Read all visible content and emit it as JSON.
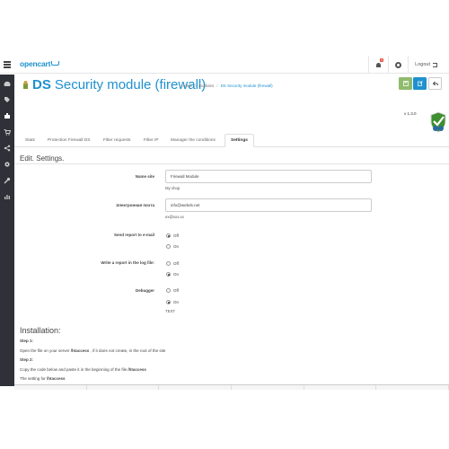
{
  "header": {
    "logo": "opencart",
    "notification_count": "3",
    "logout_label": "Logout"
  },
  "sidebar": {
    "items": [
      "dashboard-icon",
      "tags-icon",
      "puzzle-icon",
      "cart-icon",
      "share-icon",
      "cog-icon",
      "wrench-icon",
      "bar-chart-icon"
    ]
  },
  "page": {
    "title_prefix": "DS",
    "title": "Security module (firewall)",
    "breadcrumb": [
      "Home",
      "modules",
      "DS Security module (firewall)"
    ],
    "version": "v 1.3.0"
  },
  "tabs": [
    "Stats",
    "Protection Firewall DS",
    "Filter requests",
    "Filter IP",
    "Manager the conditions",
    "Settings"
  ],
  "active_tab": "Settings",
  "section_title": "Edit. Settings.",
  "form": {
    "name_site": {
      "label": "Name site",
      "value": "Firewall Module",
      "help": "My shop"
    },
    "email": {
      "label": "Электронная почта",
      "value": "info@webds.net",
      "help": "ex@xxx.xx"
    },
    "send_report": {
      "label": "Send report to e-mail",
      "options": [
        "Off",
        "On"
      ],
      "selected": "Off"
    },
    "write_log": {
      "label": "Write a report in the log file:",
      "options": [
        "Off",
        "On"
      ],
      "selected": "On"
    },
    "debugger": {
      "label": "Debugger",
      "options": [
        "Off",
        "On"
      ],
      "selected": "On",
      "help": "TEST"
    }
  },
  "installation": {
    "title": "Installation:",
    "step1_label": "Step 1:",
    "step1_text_a": "Open the file on your server ",
    "step1_file": "/htaccess",
    "step1_text_b": " , if it does not create, in the root of the site",
    "step2_label": "Step 2:",
    "step2_text_a": "Copy the code below and paste it in the beginning of the file ",
    "step2_file": "/htaccess",
    "step3_text_a": "The setting for ",
    "step3_file": "/htaccess"
  },
  "colors": {
    "brand_blue": "#1e91cf",
    "sidebar_bg": "#2e3137",
    "save_green": "#8fbb6c",
    "badge_red": "#e3503e"
  }
}
